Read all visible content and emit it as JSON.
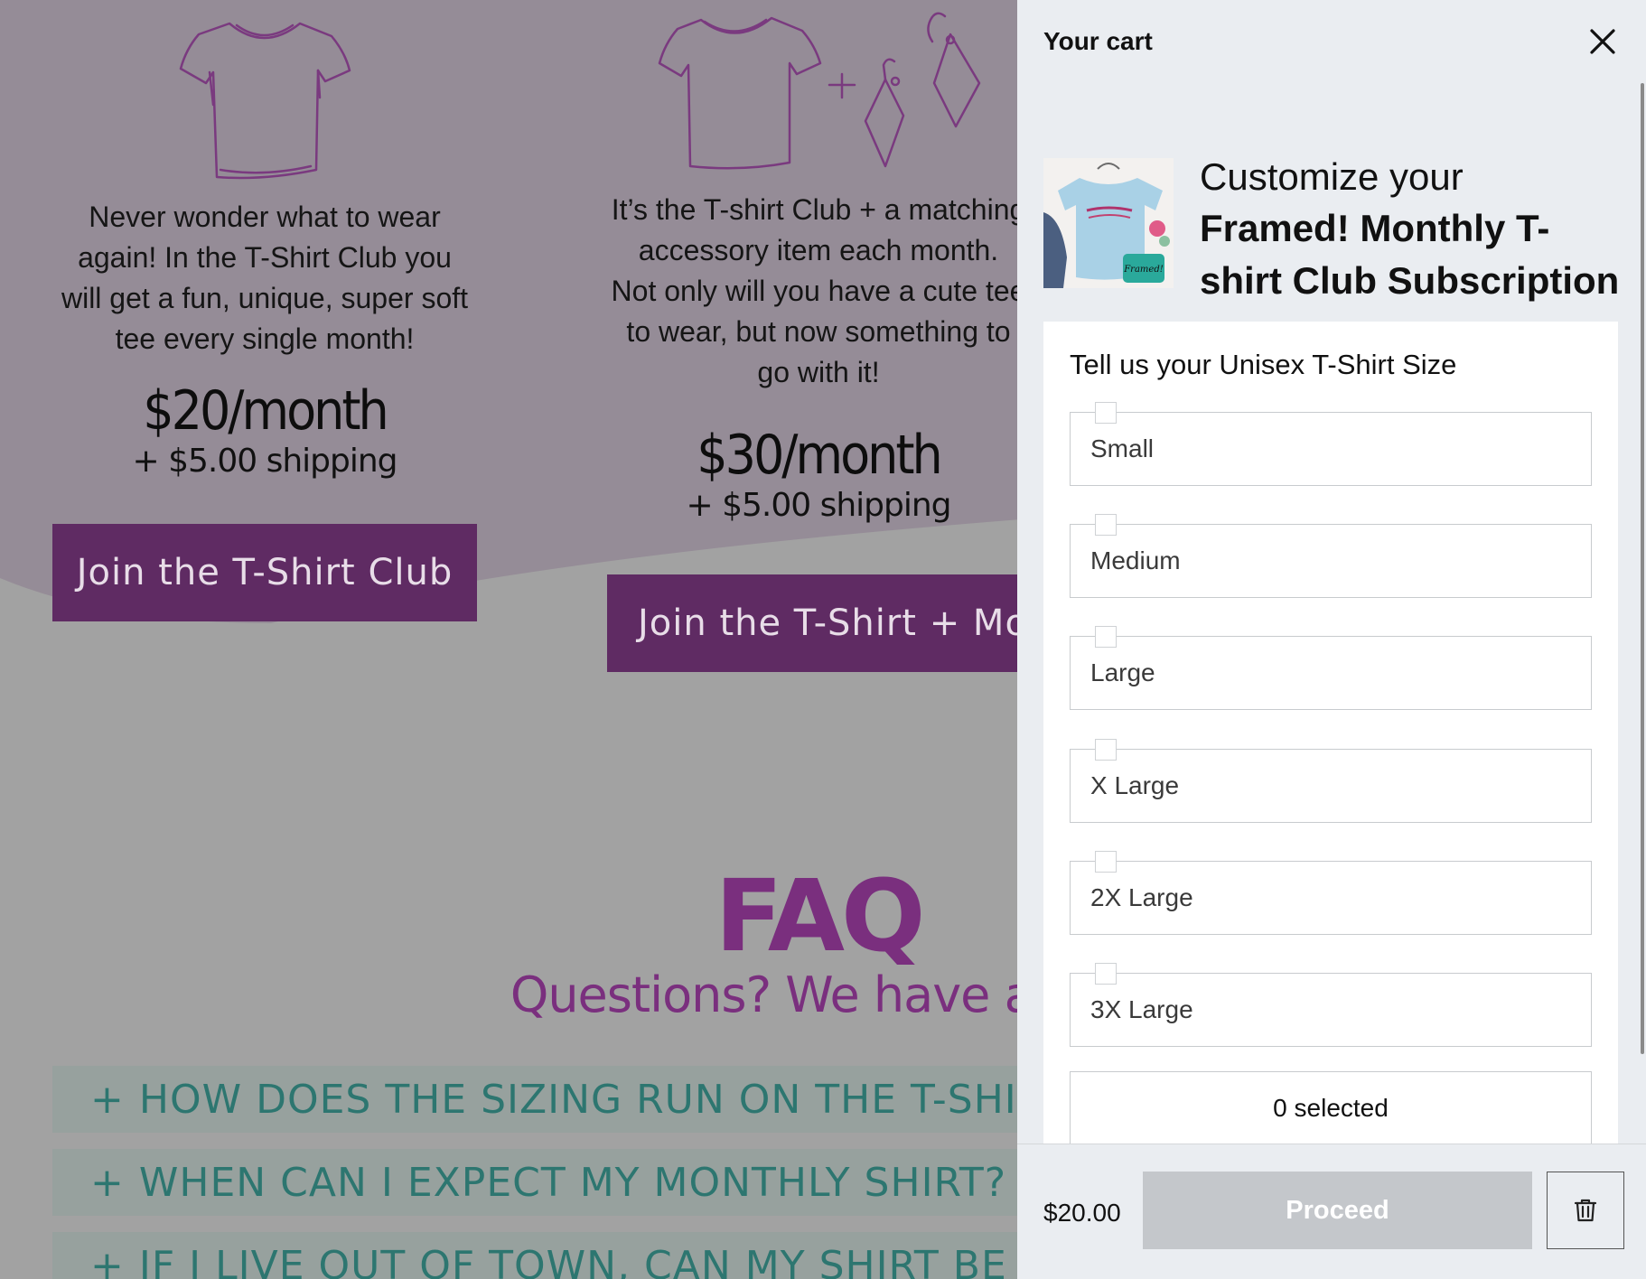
{
  "plans": [
    {
      "description": [
        "Never wonder what to wear",
        "again!  In the T-Shirt Club you",
        "will get a fun, unique, super soft",
        "tee every single month!"
      ],
      "price": "$20/month",
      "shipping": "+ $5.00 shipping",
      "button": "Join the T-Shirt Club",
      "icon": "tshirt-icon"
    },
    {
      "description": [
        "It’s the T-shirt Club + a matching",
        "accessory item each month.",
        "Not only will you have a cute tee",
        "to wear, but now something to",
        "go with it!"
      ],
      "price": "$30/month",
      "shipping": "+ $5.00 shipping",
      "button": "Join the T-Shirt + More",
      "icon": "tshirt-plus-earrings-icon"
    }
  ],
  "faq": {
    "title": "FAQ",
    "subtitle": "Questions? We have answ",
    "items": [
      "HOW DOES THE SIZING RUN ON THE T-SHIRTS?",
      "WHEN CAN I EXPECT MY MONTHLY SHIRT?",
      "IF I LIVE OUT OF TOWN, CAN MY SHIRT BE SHIPPED?"
    ]
  },
  "cart": {
    "title": "Your cart",
    "product_prefix": "Customize your",
    "product_name": "Framed! Monthly T-shirt Club Subscription",
    "options_heading": "Tell us your Unisex T-Shirt Size",
    "sizes": [
      "Small",
      "Medium",
      "Large",
      "X Large",
      "2X Large",
      "3X Large"
    ],
    "selected_text": "0 selected",
    "total": "$20.00",
    "proceed_label": "Proceed",
    "thumb_text": "Framed!"
  },
  "colors": {
    "accent_purple": "#5f2b63",
    "faq_purple": "#7a2f7e",
    "faq_teal": "#2d7670",
    "drawer_bg": "#eaedf1"
  }
}
